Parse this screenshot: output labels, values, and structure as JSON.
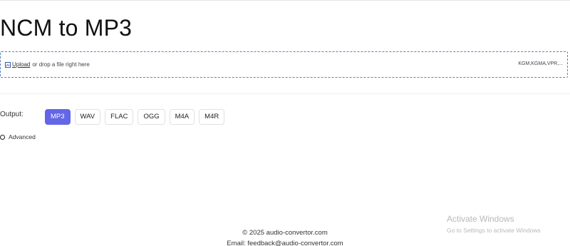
{
  "header": {
    "title": "NCM to MP3"
  },
  "upload": {
    "link_label": "Upload",
    "hint": "or drop a file right here",
    "formats": "KGM,KGMA,VPR,...",
    "icon": "upload-image-icon"
  },
  "output": {
    "label": "Output:",
    "selected": "MP3",
    "formats": [
      "MP3",
      "WAV",
      "FLAC",
      "OGG",
      "M4A",
      "M4R"
    ],
    "accent_color": "#6366e6"
  },
  "advanced": {
    "label": "Advanced"
  },
  "footer": {
    "copyright": "© 2025 audio-convertor.com",
    "email": "Email: feedback@audio-convertor.com"
  },
  "watermark": {
    "title": "Activate Windows",
    "subtitle": "Go to Settings to activate Windows"
  }
}
